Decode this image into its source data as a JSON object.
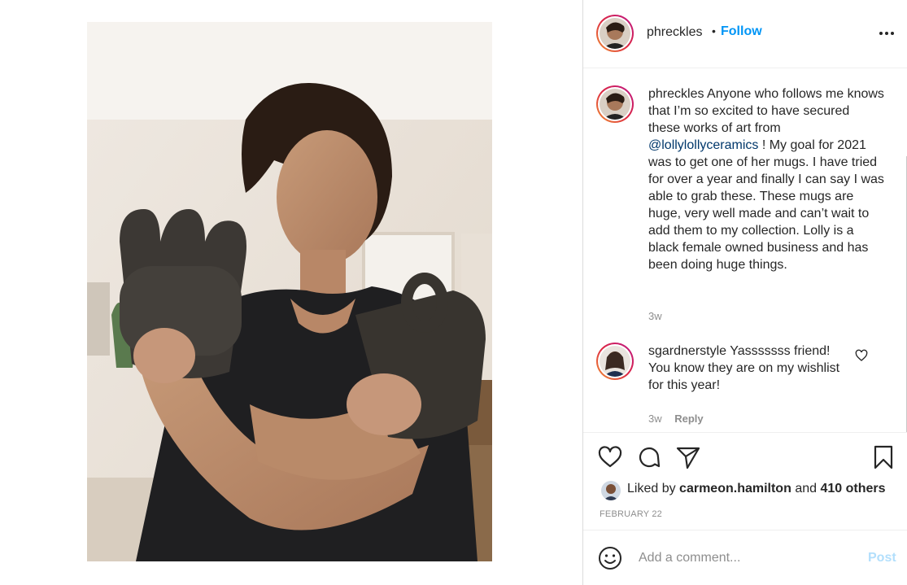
{
  "header": {
    "username": "phreckles",
    "separator": "•",
    "follow_label": "Follow",
    "more_icon": "more-horizontal-icon"
  },
  "caption": {
    "username": "phreckles",
    "text_before": "Anyone who follows me knows that I’m so excited to have secured these works of art from",
    "mention": "@lollylollyceramics",
    "text_after": "! My goal for 2021 was to get one of her mugs. I have tried for over a year and finally I can say I was able to grab these. These mugs are huge, very well made and can’t wait to add them to my collection. Lolly is a black female owned business and has been doing huge things.",
    "time": "3w"
  },
  "comments": [
    {
      "username": "sgardnerstyle",
      "text": "Yasssssss friend! You know they are on my wishlist for this year!",
      "time": "3w",
      "reply_label": "Reply"
    }
  ],
  "actions": {
    "icons": [
      "heart-icon",
      "comment-icon",
      "share-icon",
      "bookmark-icon"
    ]
  },
  "likes": {
    "prefix": "Liked by",
    "user": "carmeon.hamilton",
    "connector": "and",
    "others": "410 others"
  },
  "date": "FEBRUARY 22",
  "add_comment": {
    "placeholder": "Add a comment...",
    "post_label": "Post"
  },
  "colors": {
    "accent": "#0095f6",
    "post_disabled": "#b2dffc",
    "text": "#262626",
    "muted": "#8e8e8e",
    "mention": "#00376b"
  }
}
